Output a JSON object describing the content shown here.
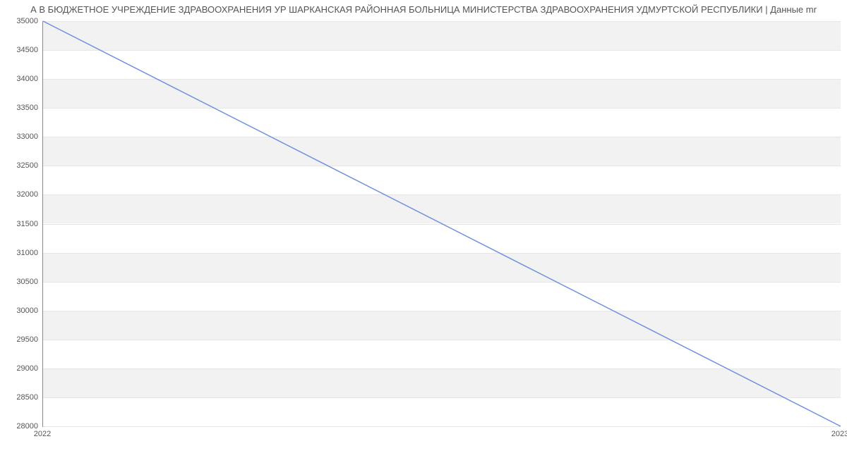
{
  "chart_data": {
    "type": "line",
    "title": "А В БЮДЖЕТНОЕ УЧРЕЖДЕНИЕ ЗДРАВООХРАНЕНИЯ УР ШАРКАНСКАЯ РАЙОННАЯ БОЛЬНИЦА МИНИСТЕРСТВА ЗДРАВООХРАНЕНИЯ УДМУРТСКОЙ РЕСПУБЛИКИ | Данные mr",
    "xlabel": "",
    "ylabel": "",
    "x": [
      "2022",
      "2023"
    ],
    "series": [
      {
        "name": "",
        "values": [
          35000,
          28000
        ]
      }
    ],
    "x_ticks": [
      "2022",
      "2023"
    ],
    "y_ticks": [
      28000,
      28500,
      29000,
      29500,
      30000,
      30500,
      31000,
      31500,
      32000,
      32500,
      33000,
      33500,
      34000,
      34500,
      35000
    ],
    "ylim": [
      28000,
      35000
    ],
    "grid": true,
    "legend": false,
    "alternating_bands": true
  }
}
